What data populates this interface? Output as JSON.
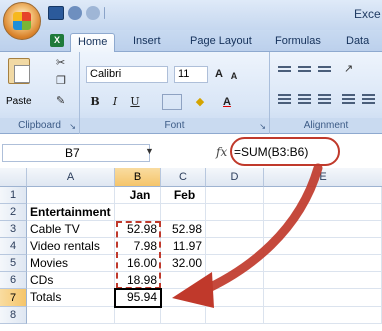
{
  "title_bar": {
    "app_title": "Exce"
  },
  "ribbon_tabs": [
    "Home",
    "Insert",
    "Page Layout",
    "Formulas",
    "Data"
  ],
  "ribbon": {
    "clipboard": {
      "paste_label": "Paste",
      "group_label": "Clipboard"
    },
    "font": {
      "font_name": "Calibri",
      "font_size": "11",
      "grow": "A",
      "shrink": "A",
      "bold": "B",
      "italic": "I",
      "underline": "U",
      "group_label": "Font"
    },
    "alignment": {
      "group_label": "Alignment"
    }
  },
  "formula_bar": {
    "name_box": "B7",
    "fx": "fx",
    "formula": "=SUM(B3:B6)"
  },
  "sheet": {
    "columns": [
      "A",
      "B",
      "C",
      "D",
      "E"
    ],
    "rows": [
      "1",
      "2",
      "3",
      "4",
      "5",
      "6",
      "7",
      "8"
    ],
    "cells": {
      "b1": "Jan",
      "c1": "Feb",
      "a2": "Entertainment",
      "a3": "Cable TV",
      "b3": "52.98",
      "c3": "52.98",
      "a4": "Video rentals",
      "b4": "7.98",
      "c4": "11.97",
      "a5": "Movies",
      "b5": "16.00",
      "c5": "32.00",
      "a6": "CDs",
      "b6": "18.98",
      "a7": "Totals",
      "b7": "95.94"
    }
  },
  "colors": {
    "annotation": "#c0392b",
    "selected_header": "#f5c56a"
  }
}
